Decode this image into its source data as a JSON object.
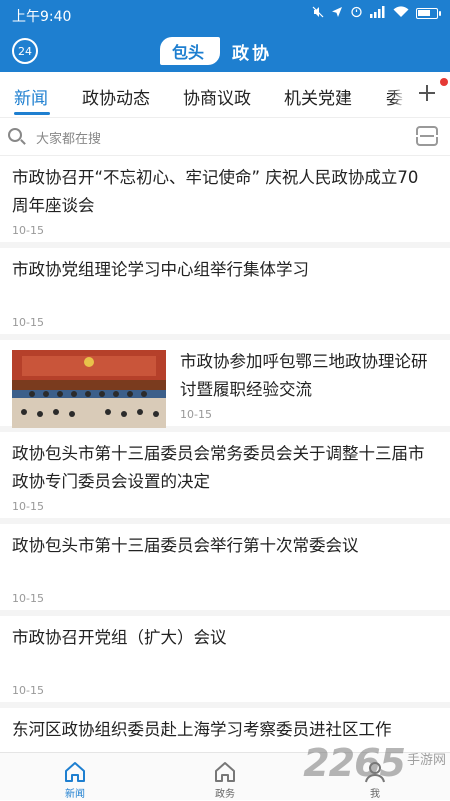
{
  "status_bar": {
    "time": "上午9:40"
  },
  "app": {
    "history_badge": "24",
    "logo_plate": "包头",
    "logo_word": "政协"
  },
  "tabs": [
    {
      "label": "新闻",
      "active": true
    },
    {
      "label": "政协动态"
    },
    {
      "label": "协商议政"
    },
    {
      "label": "机关党建"
    },
    {
      "label": "委员"
    }
  ],
  "tab_more_icon": "plus-icon",
  "search": {
    "placeholder": "大家都在搜"
  },
  "news": [
    {
      "title": "市政协召开“不忘初心、牢记使命” 庆祝人民政协成立70周年座谈会",
      "date": "10-15",
      "has_image": false
    },
    {
      "title": "市政协党组理论学习中心组举行集体学习",
      "date": "10-15",
      "has_image": false
    },
    {
      "title": "市政协参加呼包鄂三地政协理论研讨暨履职经验交流",
      "date": "10-15",
      "has_image": true
    },
    {
      "title": "政协包头市第十三届委员会常务委员会关于调整十三届市政协专门委员会设置的决定",
      "date": "10-15",
      "has_image": false
    },
    {
      "title": "政协包头市第十三届委员会举行第十次常委会议",
      "date": "10-15",
      "has_image": false
    },
    {
      "title": "市政协召开党组（扩大）会议",
      "date": "10-15",
      "has_image": false
    },
    {
      "title": "东河区政协组织委员赴上海学习考察委员进社区工作",
      "date": "",
      "has_image": false
    }
  ],
  "bottom_nav": [
    {
      "label": "新闻",
      "icon": "home-icon",
      "active": true
    },
    {
      "label": "政务",
      "icon": "home-outline-icon"
    },
    {
      "label": "我",
      "icon": "user-icon"
    }
  ],
  "watermark": {
    "number": "2265",
    "text": "手游网"
  },
  "colors": {
    "primary": "#1e7fd0",
    "divider": "#f4f4f4",
    "badge_red": "#e53935"
  }
}
